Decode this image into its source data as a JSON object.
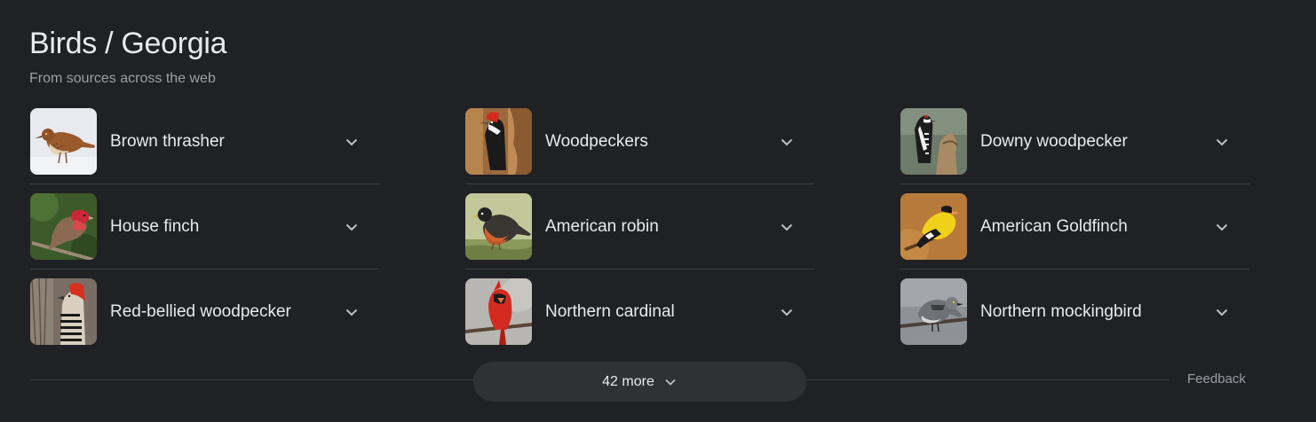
{
  "header": {
    "title": "Birds / Georgia",
    "subtitle": "From sources across the web"
  },
  "birds": [
    {
      "name": "Brown thrasher",
      "icon": "brown-thrasher-image"
    },
    {
      "name": "Woodpeckers",
      "icon": "woodpeckers-image"
    },
    {
      "name": "Downy woodpecker",
      "icon": "downy-woodpecker-image"
    },
    {
      "name": "House finch",
      "icon": "house-finch-image"
    },
    {
      "name": "American robin",
      "icon": "american-robin-image"
    },
    {
      "name": "American Goldfinch",
      "icon": "american-goldfinch-image"
    },
    {
      "name": "Red-bellied woodpecker",
      "icon": "red-bellied-woodpecker-image"
    },
    {
      "name": "Northern cardinal",
      "icon": "northern-cardinal-image"
    },
    {
      "name": "Northern mockingbird",
      "icon": "northern-mockingbird-image"
    }
  ],
  "footer": {
    "more_label": "42 more",
    "feedback_label": "Feedback"
  },
  "colors": {
    "background": "#202124",
    "text_primary": "#e8eaed",
    "text_secondary": "#9aa0a6",
    "divider": "#3c4043",
    "button_bg": "#303134"
  }
}
